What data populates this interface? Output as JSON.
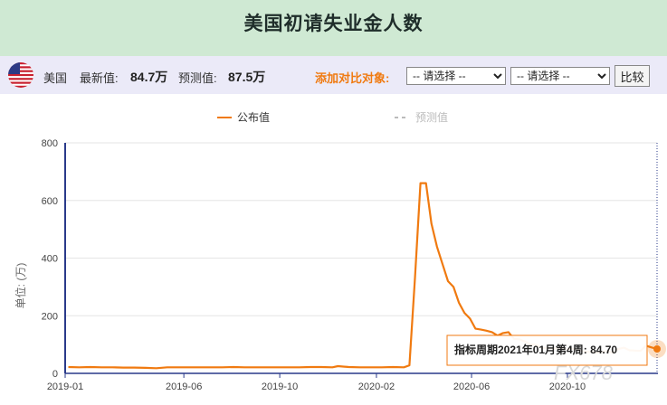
{
  "header": {
    "title": "美国初请失业金人数"
  },
  "infobar": {
    "country": "美国",
    "latest_label": "最新值:",
    "latest_value": "84.7万",
    "forecast_label": "预测值:",
    "forecast_value": "87.5万",
    "compare_label": "添加对比对象:",
    "select1": {
      "selected": "-- 请选择 --"
    },
    "select2": {
      "selected": "-- 请选择 --"
    },
    "compare_button": "比较"
  },
  "colors": {
    "header_bg": "#cfe9d3",
    "infobar_bg": "#ebeaf8",
    "line": "#f07a10",
    "forecast": "#bbbbbb",
    "accent": "#f07a10"
  },
  "chart_data": {
    "type": "line",
    "legend": [
      "公布值",
      "预测值"
    ],
    "legend_position": "top-center",
    "ylabel": "单位: (万)",
    "ylim": [
      0,
      800
    ],
    "yticks": [
      0,
      200,
      400,
      600,
      800
    ],
    "xticks": [
      "2019-01",
      "2019-06",
      "2019-10",
      "2020-02",
      "2020-06",
      "2020-10"
    ],
    "grid": "horizontal",
    "series": [
      {
        "name": "公布值",
        "points": [
          [
            "2019-01-05",
            22
          ],
          [
            "2019-01-19",
            21
          ],
          [
            "2019-02-02",
            22
          ],
          [
            "2019-02-16",
            21
          ],
          [
            "2019-03-02",
            21
          ],
          [
            "2019-03-16",
            20
          ],
          [
            "2019-03-30",
            20
          ],
          [
            "2019-04-13",
            19
          ],
          [
            "2019-04-27",
            18
          ],
          [
            "2019-05-11",
            21
          ],
          [
            "2019-05-25",
            21
          ],
          [
            "2019-06-08",
            21
          ],
          [
            "2019-06-22",
            21
          ],
          [
            "2019-07-06",
            21
          ],
          [
            "2019-07-20",
            21
          ],
          [
            "2019-08-03",
            22
          ],
          [
            "2019-08-17",
            21
          ],
          [
            "2019-08-31",
            21
          ],
          [
            "2019-09-14",
            21
          ],
          [
            "2019-09-28",
            21
          ],
          [
            "2019-10-12",
            21
          ],
          [
            "2019-10-26",
            21
          ],
          [
            "2019-11-09",
            22
          ],
          [
            "2019-11-23",
            22
          ],
          [
            "2019-12-07",
            21
          ],
          [
            "2019-12-14",
            25
          ],
          [
            "2019-12-28",
            22
          ],
          [
            "2020-01-11",
            21
          ],
          [
            "2020-01-25",
            21
          ],
          [
            "2020-02-08",
            21
          ],
          [
            "2020-02-22",
            22
          ],
          [
            "2020-03-07",
            21
          ],
          [
            "2020-03-14",
            28
          ],
          [
            "2020-03-21",
            330
          ],
          [
            "2020-03-28",
            660
          ],
          [
            "2020-04-04",
            660
          ],
          [
            "2020-04-11",
            520
          ],
          [
            "2020-04-18",
            440
          ],
          [
            "2020-04-25",
            380
          ],
          [
            "2020-05-02",
            320
          ],
          [
            "2020-05-09",
            300
          ],
          [
            "2020-05-16",
            245
          ],
          [
            "2020-05-23",
            210
          ],
          [
            "2020-05-30",
            190
          ],
          [
            "2020-06-06",
            155
          ],
          [
            "2020-06-13",
            152
          ],
          [
            "2020-06-20",
            148
          ],
          [
            "2020-06-27",
            143
          ],
          [
            "2020-07-04",
            131
          ],
          [
            "2020-07-11",
            140
          ],
          [
            "2020-07-18",
            143
          ],
          [
            "2020-07-25",
            120
          ],
          [
            "2020-08-01",
            118
          ],
          [
            "2020-08-08",
            110
          ],
          [
            "2020-08-15",
            100
          ],
          [
            "2020-08-22",
            100
          ],
          [
            "2020-08-29",
            88
          ],
          [
            "2020-09-05",
            88
          ],
          [
            "2020-09-12",
            86
          ],
          [
            "2020-09-19",
            87
          ],
          [
            "2020-09-26",
            84
          ],
          [
            "2020-10-03",
            84
          ],
          [
            "2020-10-10",
            86
          ],
          [
            "2020-10-17",
            79
          ],
          [
            "2020-10-24",
            75
          ],
          [
            "2020-10-31",
            75
          ],
          [
            "2020-11-07",
            71
          ],
          [
            "2020-11-14",
            74
          ],
          [
            "2020-11-21",
            78
          ],
          [
            "2020-11-28",
            71
          ],
          [
            "2020-12-05",
            85
          ],
          [
            "2020-12-12",
            89
          ],
          [
            "2020-12-19",
            80
          ],
          [
            "2020-12-26",
            79
          ],
          [
            "2021-01-02",
            78
          ],
          [
            "2021-01-09",
            96
          ],
          [
            "2021-01-16",
            90
          ],
          [
            "2021-01-23",
            84.7
          ]
        ]
      }
    ],
    "tooltip": {
      "label": "指标周期2021年01月第4周:",
      "value": "84.70"
    },
    "watermark": "FX678"
  }
}
